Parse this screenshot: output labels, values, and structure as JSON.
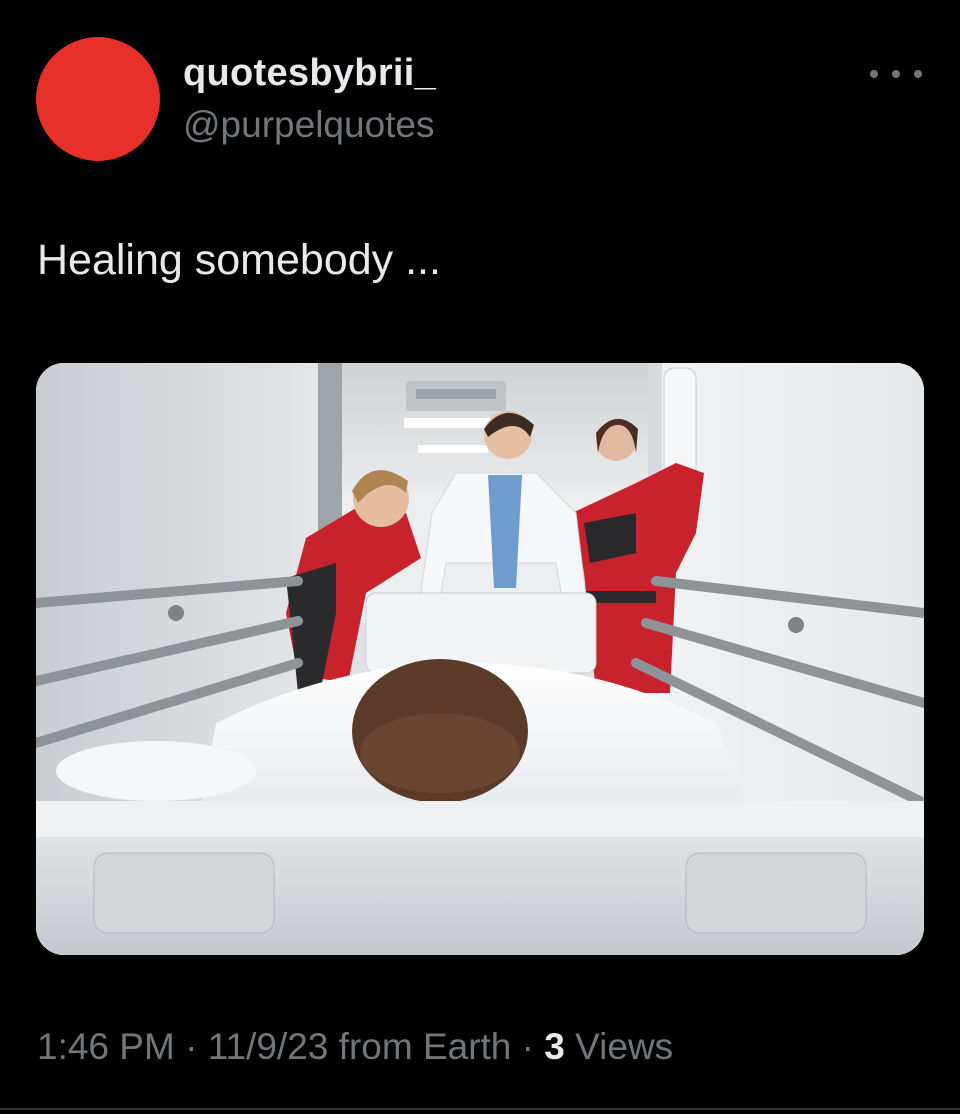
{
  "colors": {
    "background": "#000000",
    "avatar": "#e8302a",
    "primary_text": "#e7e9ea",
    "secondary_text": "#71767b"
  },
  "author": {
    "display_name": "quotesbybrii_",
    "handle": "@purpelquotes",
    "avatar_icon": "avatar-red-circle"
  },
  "more_menu": {
    "icon": "more-horizontal-icon"
  },
  "tweet": {
    "text": "Healing somebody ..."
  },
  "meta": {
    "time": "1:46 PM",
    "separator": "·",
    "date": "11/9/23",
    "source": "from Earth",
    "views_count": "3",
    "views_label": "Views"
  }
}
